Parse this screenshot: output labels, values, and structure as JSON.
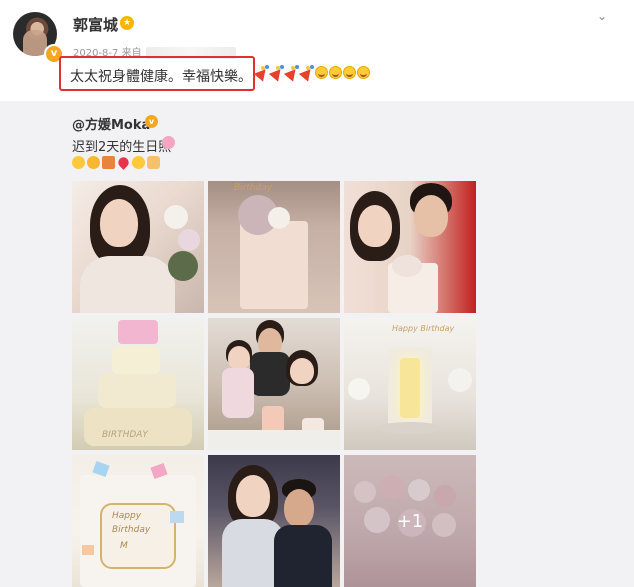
{
  "post": {
    "username": "郭富城",
    "meta_date": "2020-8-7",
    "meta_source": "来自",
    "content": "太太祝身體健康。幸福快樂。",
    "emoji_row": [
      "party-popper",
      "party-popper",
      "party-popper",
      "party-popper",
      "smile",
      "smile",
      "smile",
      "smile"
    ]
  },
  "repost": {
    "username": "@方媛Moka",
    "text": "迟到2天的生日照",
    "emojis": [
      "hug-emoji",
      "hug-emoji",
      "gift-emoji",
      "heart-emoji",
      "kiss-emoji",
      "pray-emoji"
    ],
    "photo_more": "+1",
    "cake_texts": {
      "cake1": "Birthday",
      "cake4": "BIRTHDAY",
      "cake6": "Happy Birthday",
      "cake7_line1": "Happy",
      "cake7_line2": "Birthday",
      "cake7_line3": "M"
    }
  },
  "colors": {
    "highlight_border": "#e03030",
    "verified_badge": "#f5a623",
    "repost_bg": "#f2f2f5"
  }
}
